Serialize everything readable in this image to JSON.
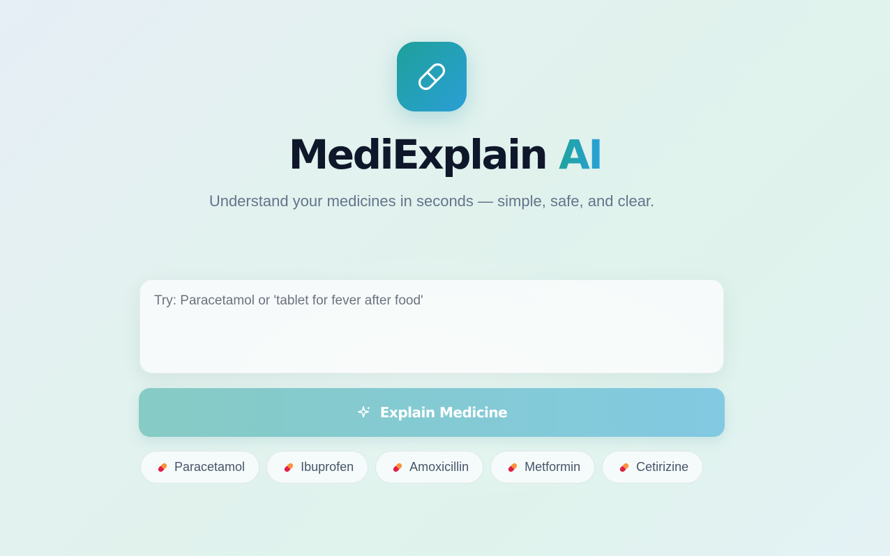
{
  "app": {
    "title_main": "MediExplain",
    "title_accent": "AI",
    "subtitle": "Understand your medicines in seconds — simple, safe, and clear.",
    "logo_icon": "pill-icon"
  },
  "search": {
    "placeholder": "Try: Paracetamol or 'tablet for fever after food'",
    "value": ""
  },
  "action": {
    "label": "Explain Medicine",
    "icon": "sparkle-icon"
  },
  "suggestions": [
    {
      "label": "Paracetamol",
      "icon": "pill-emoji-icon"
    },
    {
      "label": "Ibuprofen",
      "icon": "pill-emoji-icon"
    },
    {
      "label": "Amoxicillin",
      "icon": "pill-emoji-icon"
    },
    {
      "label": "Metformin",
      "icon": "pill-emoji-icon"
    },
    {
      "label": "Cetirizine",
      "icon": "pill-emoji-icon"
    }
  ],
  "colors": {
    "brand_teal": "#1ea09a",
    "brand_blue": "#2a9fd6",
    "title_dark": "#0f172a",
    "subtitle_gray": "#64748b",
    "pill_red": "#e11d48",
    "pill_orange": "#f97316"
  }
}
